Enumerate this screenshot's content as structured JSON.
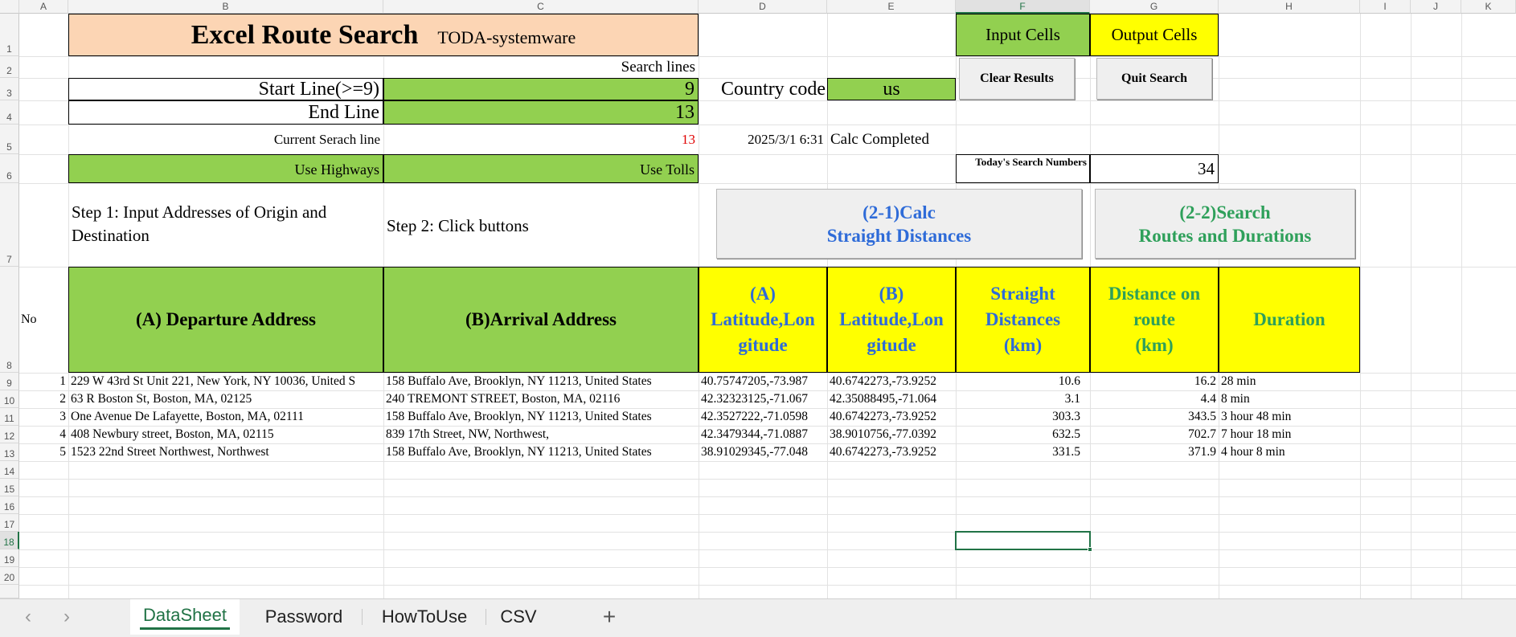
{
  "columns": [
    "A",
    "B",
    "C",
    "D",
    "E",
    "F",
    "G",
    "H",
    "I",
    "J",
    "K"
  ],
  "rows": [
    "1",
    "2",
    "3",
    "4",
    "5",
    "6",
    "7",
    "8",
    "9",
    "10",
    "11",
    "12",
    "13",
    "14",
    "15",
    "16",
    "17",
    "18",
    "19",
    "20"
  ],
  "title": {
    "main": "Excel Route Search",
    "sub": "TODA-systemware"
  },
  "legend": {
    "input": "Input Cells",
    "output": "Output Cells"
  },
  "search_lines_label": "Search lines",
  "start_line": {
    "label": "Start Line(>=9)",
    "value": "9"
  },
  "end_line": {
    "label": "End Line",
    "value": "13"
  },
  "country_code": {
    "label": "Country code",
    "value": "us"
  },
  "current_line": {
    "label": "Current Serach line",
    "value": "13"
  },
  "timestamp": "2025/3/1 6:31",
  "status": "Calc Completed",
  "use_highways": "Use Highways",
  "use_tolls": "Use Tolls",
  "today_search": {
    "label": "Today's Search Numbers",
    "value": "34"
  },
  "buttons": {
    "clear": "Clear Results",
    "quit": "Quit Search",
    "calc_line1": "(2-1)Calc",
    "calc_line2": "Straight Distances",
    "search_line1": "(2-2)Search",
    "search_line2": "Routes and Durations"
  },
  "steps": {
    "step1_line1": "Step 1: Input Addresses of Origin and",
    "step1_line2": "Destination",
    "step2": "Step 2: Click buttons"
  },
  "table_headers": {
    "no": "No",
    "departure": "(A) Departure Address",
    "arrival": "(B)Arrival Address",
    "a_lat_1": "(A)",
    "a_lat_2": "Latitude,Lon",
    "a_lat_3": "gitude",
    "b_lat_1": "(B)",
    "b_lat_2": "Latitude,Lon",
    "b_lat_3": "gitude",
    "straight_1": "Straight",
    "straight_2": "Distances",
    "straight_3": "(km)",
    "route_1": "Distance on",
    "route_2": "route",
    "route_3": "(km)",
    "duration": "Duration"
  },
  "table_rows": [
    {
      "no": "1",
      "dep": "229 W 43rd St Unit 221, New York, NY 10036, United S",
      "arr": "158 Buffalo Ave, Brooklyn, NY 11213, United States",
      "a": "40.75747205,-73.987",
      "b": "40.6742273,-73.9252",
      "straight": "10.6",
      "route": "16.2",
      "dur": "28 min"
    },
    {
      "no": "2",
      "dep": "63 R Boston St, Boston, MA, 02125",
      "arr": "240 TREMONT STREET, Boston, MA, 02116",
      "a": "42.32323125,-71.067",
      "b": "42.35088495,-71.064",
      "straight": "3.1",
      "route": "4.4",
      "dur": "8 min"
    },
    {
      "no": "3",
      "dep": "One Avenue De Lafayette, Boston, MA, 02111",
      "arr": "158 Buffalo Ave, Brooklyn, NY 11213, United States",
      "a": "42.3527222,-71.0598",
      "b": "40.6742273,-73.9252",
      "straight": "303.3",
      "route": "343.5",
      "dur": "3 hour 48 min"
    },
    {
      "no": "4",
      "dep": "408 Newbury street, Boston, MA, 02115",
      "arr": "839 17th Street, NW, Northwest,",
      "a": "42.3479344,-71.0887",
      "b": "38.9010756,-77.0392",
      "straight": "632.5",
      "route": "702.7",
      "dur": "7 hour 18 min"
    },
    {
      "no": "5",
      "dep": "1523 22nd Street Northwest, Northwest",
      "arr": "158 Buffalo Ave, Brooklyn, NY 11213, United States",
      "a": "38.91029345,-77.048",
      "b": "40.6742273,-73.9252",
      "straight": "331.5",
      "route": "371.9",
      "dur": "4 hour 8 min"
    }
  ],
  "sheet_tabs": [
    "DataSheet",
    "Password",
    "HowToUse",
    "CSV"
  ],
  "active_tab": "DataSheet",
  "colors": {
    "input": "#92d050",
    "output": "#ffff00",
    "title": "#fcd5b4",
    "blue_text": "#2e6bd8",
    "green_text": "#2ea05a",
    "excel_green": "#217346"
  }
}
